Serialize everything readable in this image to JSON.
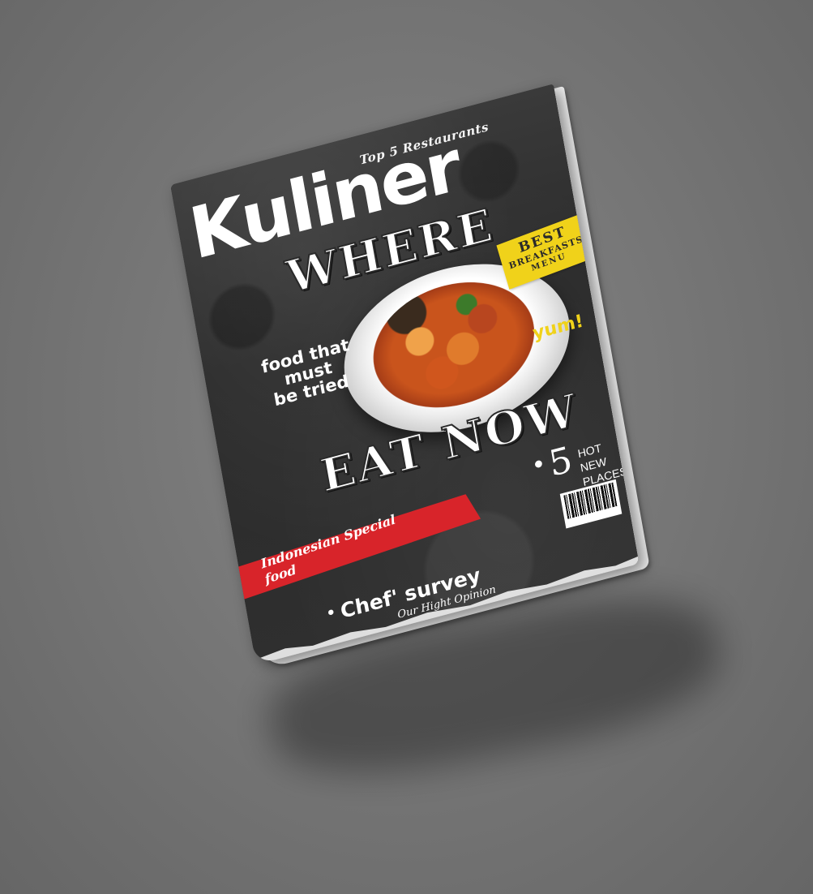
{
  "magazine": {
    "kicker": "Top 5 Restaurants",
    "title": "Kuliner",
    "headline_top": "WHERE",
    "side_line1": "food that",
    "side_line2": "must",
    "side_line3": "be tried",
    "badge_line1": "BEST",
    "badge_line2": "BREAKFASTS",
    "badge_line3": "MENU",
    "exclaim": "yum!",
    "headline_bottom": "EAT NOW",
    "count": "5",
    "count_label_line1": "HOT NEW",
    "count_label_line2": "PLACES",
    "banner_line1": "Indonesian Special",
    "banner_line2": "food",
    "feature_title": "Chef' survey",
    "feature_subtitle": "Our Hight Opinion"
  },
  "colors": {
    "cover_background": "#2f2f2f",
    "badge_yellow": "#f0d21a",
    "banner_red": "#d8242a",
    "backdrop_gray": "#747474"
  }
}
